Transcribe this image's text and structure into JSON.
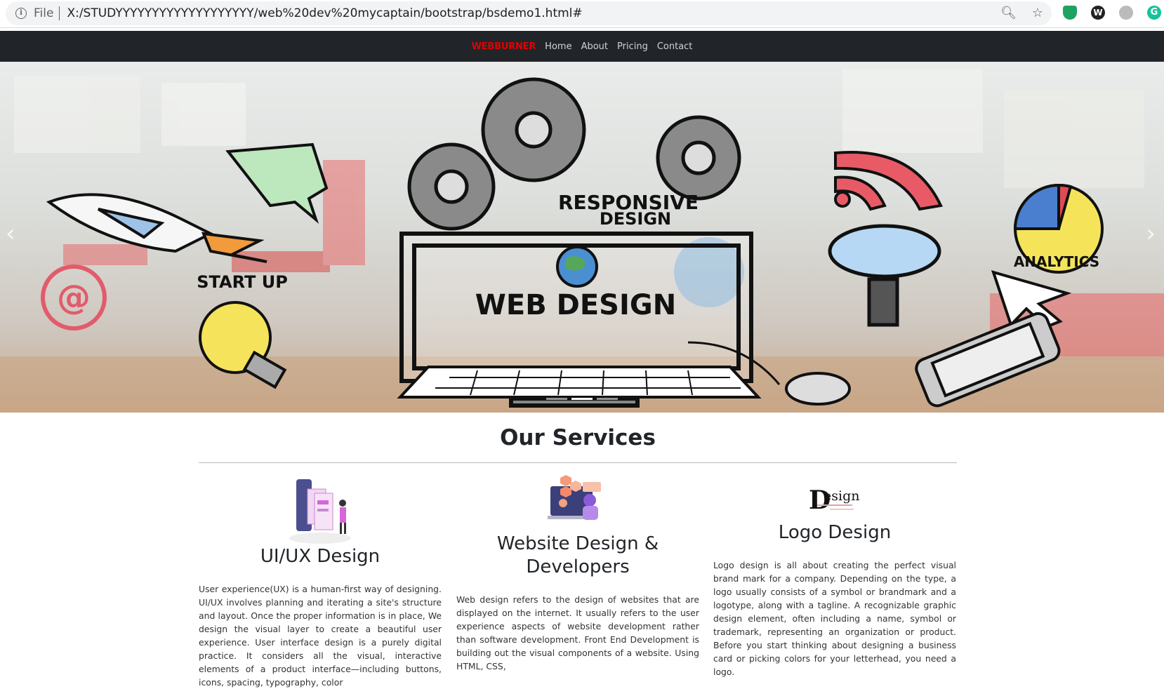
{
  "browser": {
    "scheme": "File",
    "url": "X:/STUDYYYYYYYYYYYYYYYYYYY/web%20dev%20mycaptain/bootstrap/bsdemo1.html#"
  },
  "navbar": {
    "brand": "WEBBURNER",
    "links": [
      "Home",
      "About",
      "Pricing",
      "Contact"
    ]
  },
  "hero": {
    "labels": {
      "responsive": "RESPONSIVE",
      "design": "DESIGN",
      "startup": "START UP",
      "webdesign": "WEB DESIGN",
      "analytics": "ANALYTICS",
      "at": "@"
    },
    "prev_icon": "chevron-left-icon",
    "next_icon": "chevron-right-icon",
    "slide_count": 3,
    "active_slide": 2
  },
  "services": {
    "title": "Our Services",
    "items": [
      {
        "icon": "ux-illustration-icon",
        "title": "UI/UX Design",
        "text": "User experience(UX) is a human-first way of designing. UI/UX involves planning and iterating a site's structure and layout. Once the proper information is in place, We design the visual layer to create a beautiful user experience. User interface design is a purely digital practice. It considers all the visual, interactive elements of a product interface—including buttons, icons, spacing, typography, color"
      },
      {
        "icon": "web-dev-illustration-icon",
        "title": "Website Design & Developers",
        "text": "Web design refers to the design of websites that are displayed on the internet. It usually refers to the user experience aspects of website development rather than software development. Front End Development is building out the visual components of a website. Using HTML, CSS,"
      },
      {
        "icon": "design-logo-icon",
        "logo_text": "esign",
        "logo_initial": "D",
        "title": "Logo Design",
        "text": "Logo design is all about creating the perfect visual brand mark for a company. Depending on the type, a logo usually consists of a symbol or brandmark and a logotype, along with a tagline. A recognizable graphic design element, often including a name, symbol or trademark, representing an organization or product. Before you start thinking about designing a business card or picking colors for your letterhead, you need a logo."
      }
    ]
  },
  "colors": {
    "navbar_bg": "#212529",
    "brand": "#e00000"
  }
}
